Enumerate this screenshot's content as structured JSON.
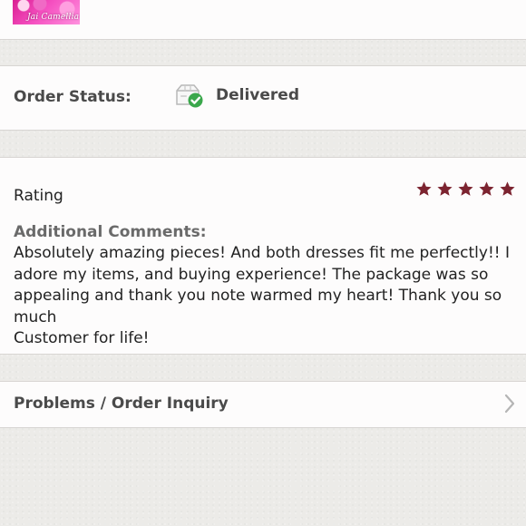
{
  "header": {
    "thumbnail_label": "Jai Camellia"
  },
  "order_status": {
    "label": "Order Status:",
    "value": "Delivered",
    "icon": "delivered-box-check-icon",
    "status_color": "#3aa74b"
  },
  "rating": {
    "title": "Rating",
    "stars": 5,
    "star_color": "#7c2430",
    "comments_label": "Additional Comments:",
    "comments_text": "Absolutely amazing pieces! And both dresses fit me perfectly!! I\nadore my items, and buying experience! The package was so\nappealing and thank you note warmed my heart! Thank you so much\nCustomer for life!"
  },
  "problems": {
    "label": "Problems / Order Inquiry",
    "icon": "chevron-right-icon"
  }
}
